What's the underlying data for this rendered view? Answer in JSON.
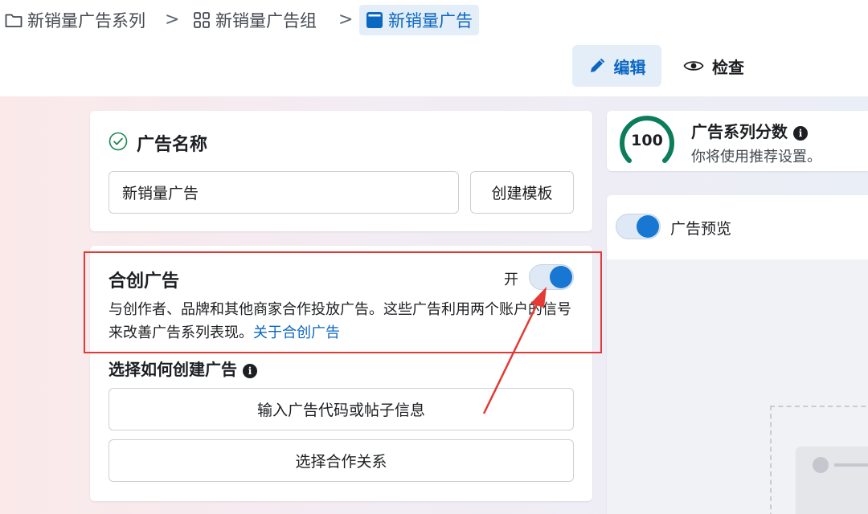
{
  "breadcrumb": {
    "items": [
      {
        "label": "新销量广告系列",
        "icon": "folder-icon"
      },
      {
        "label": "新销量广告组",
        "icon": "grid-icon"
      },
      {
        "label": "新销量广告",
        "icon": "ad-icon"
      }
    ],
    "separator": ">"
  },
  "view_tabs": {
    "edit": "编辑",
    "review": "检查"
  },
  "ad_name": {
    "title": "广告名称",
    "value": "新销量广告",
    "create_template": "创建模板"
  },
  "partnership": {
    "title": "合创广告",
    "toggle_label": "开",
    "toggle_on": true,
    "description": "与创作者、品牌和其他商家合作投放广告。这些广告利用两个账户的信号来改善广告系列表现。",
    "link": "关于合创广告",
    "how_title": "选择如何创建广告",
    "option1": "输入广告代码或帖子信息",
    "option2": "选择合作关系"
  },
  "score": {
    "value": "100",
    "title": "广告系列分数",
    "subtitle": "你将使用推荐设置。"
  },
  "preview": {
    "label": "广告预览",
    "toggle_on": true
  },
  "colors": {
    "accent": "#1877d2",
    "annotation": "#e53935",
    "score_ring": "#0b7d5a"
  }
}
